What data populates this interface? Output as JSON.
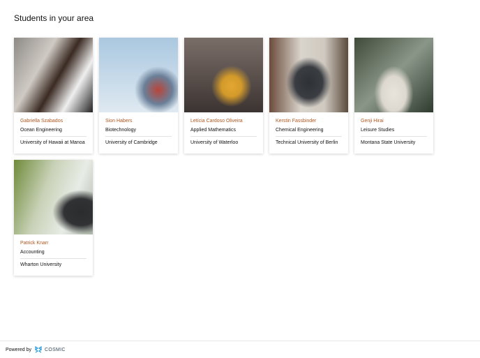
{
  "page_title": "Students in your area",
  "students": [
    {
      "name": "Gabriella Szabados",
      "field": "Ocean Engineering",
      "school": "University of Hawaii at Manoa"
    },
    {
      "name": "Sion Habers",
      "field": "Biotechnology",
      "school": "University of Cambridge"
    },
    {
      "name": "Letícia Cardoso Oliveira",
      "field": "Applied Mathematics",
      "school": "University of Waterloo"
    },
    {
      "name": "Kerstin Fassbinder",
      "field": "Chemical Engineering",
      "school": "Technical University of Berlin"
    },
    {
      "name": "Genji Hirai",
      "field": "Leisure Studies",
      "school": "Montana State University"
    },
    {
      "name": "Patrick Knarr",
      "field": "Accounting",
      "school": "Wharton University"
    }
  ],
  "footer": {
    "powered_by": "Powered by",
    "brand": "COSMIC"
  },
  "colors": {
    "name_accent": "#b0561e",
    "brand": "#2a9bd6"
  }
}
